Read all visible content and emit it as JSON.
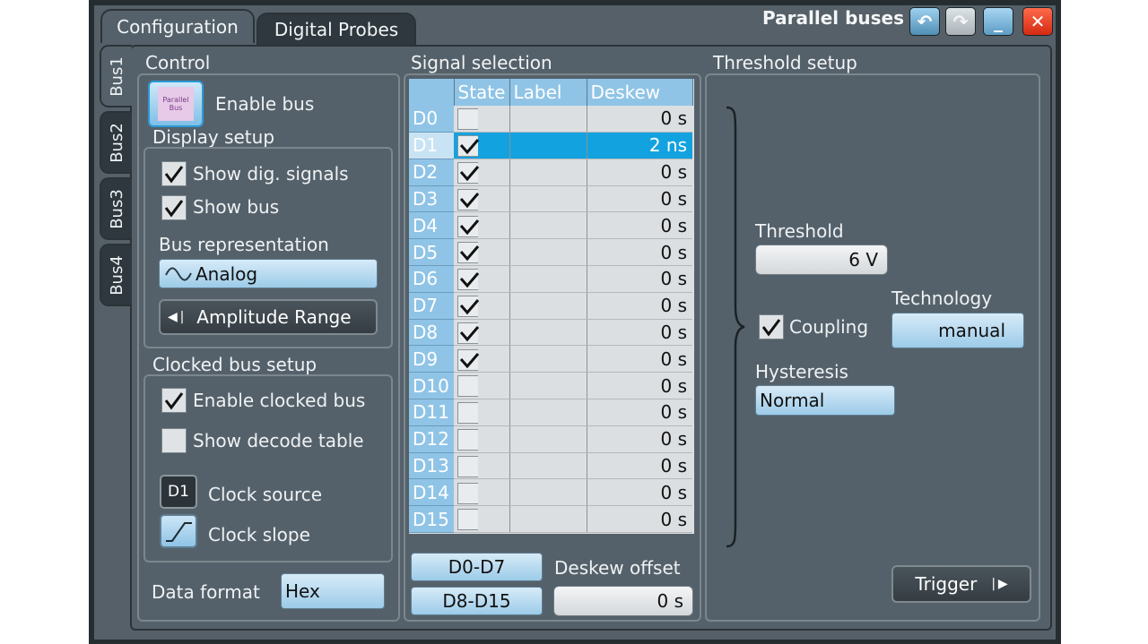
{
  "window": {
    "title": "Parallel buses",
    "tabs": [
      "Configuration",
      "Digital Probes"
    ],
    "bus_tabs": [
      "Bus1",
      "Bus2",
      "Bus3",
      "Bus4"
    ],
    "buttons": {
      "back": "↶",
      "forward": "↷",
      "minimize": "_",
      "close": "✕"
    }
  },
  "control": {
    "heading": "Control",
    "enable_bus_label": "Enable bus",
    "enable_bus_icon_text": "Parallel Bus",
    "display_setup": {
      "heading": "Display setup",
      "show_dig_signals": {
        "label": "Show dig. signals",
        "checked": true
      },
      "show_bus": {
        "label": "Show bus",
        "checked": true
      },
      "bus_representation_label": "Bus representation",
      "bus_representation_value": "Analog",
      "amplitude_range_label": "Amplitude Range"
    },
    "clocked_bus_setup": {
      "heading": "Clocked bus setup",
      "enable_clocked_bus": {
        "label": "Enable clocked bus",
        "checked": true
      },
      "show_decode_table": {
        "label": "Show decode table",
        "checked": false
      },
      "clock_source_label": "Clock source",
      "clock_source_value": "D1",
      "clock_slope_label": "Clock slope"
    },
    "data_format_label": "Data format",
    "data_format_value": "Hex"
  },
  "signal_selection": {
    "heading": "Signal selection",
    "columns": [
      "State",
      "Label",
      "Deskew"
    ],
    "rows": [
      {
        "name": "D0",
        "state": false,
        "label": "",
        "deskew": "0 s"
      },
      {
        "name": "D1",
        "state": true,
        "label": "",
        "deskew": "2 ns",
        "selected": true
      },
      {
        "name": "D2",
        "state": true,
        "label": "",
        "deskew": "0 s"
      },
      {
        "name": "D3",
        "state": true,
        "label": "",
        "deskew": "0 s"
      },
      {
        "name": "D4",
        "state": true,
        "label": "",
        "deskew": "0 s"
      },
      {
        "name": "D5",
        "state": true,
        "label": "",
        "deskew": "0 s"
      },
      {
        "name": "D6",
        "state": true,
        "label": "",
        "deskew": "0 s"
      },
      {
        "name": "D7",
        "state": true,
        "label": "",
        "deskew": "0 s"
      },
      {
        "name": "D8",
        "state": true,
        "label": "",
        "deskew": "0 s"
      },
      {
        "name": "D9",
        "state": true,
        "label": "",
        "deskew": "0 s"
      },
      {
        "name": "D10",
        "state": false,
        "label": "",
        "deskew": "0 s"
      },
      {
        "name": "D11",
        "state": false,
        "label": "",
        "deskew": "0 s"
      },
      {
        "name": "D12",
        "state": false,
        "label": "",
        "deskew": "0 s"
      },
      {
        "name": "D13",
        "state": false,
        "label": "",
        "deskew": "0 s"
      },
      {
        "name": "D14",
        "state": false,
        "label": "",
        "deskew": "0 s"
      },
      {
        "name": "D15",
        "state": false,
        "label": "",
        "deskew": "0 s"
      }
    ],
    "group_d0_d7": "D0-D7",
    "group_d8_d15": "D8-D15",
    "deskew_offset_label": "Deskew offset",
    "deskew_offset_value": "0 s"
  },
  "threshold_setup": {
    "heading": "Threshold setup",
    "threshold_label": "Threshold",
    "threshold_value": "6 V",
    "coupling": {
      "label": "Coupling",
      "checked": true
    },
    "technology_label": "Technology",
    "technology_value": "manual",
    "hysteresis_label": "Hysteresis",
    "hysteresis_value": "Normal",
    "trigger_label": "Trigger"
  },
  "colors": {
    "accent_blue": "#13a2e0",
    "header_blue": "#8fc4e6",
    "panel": "#55616a",
    "close_red": "#e23b1e"
  }
}
